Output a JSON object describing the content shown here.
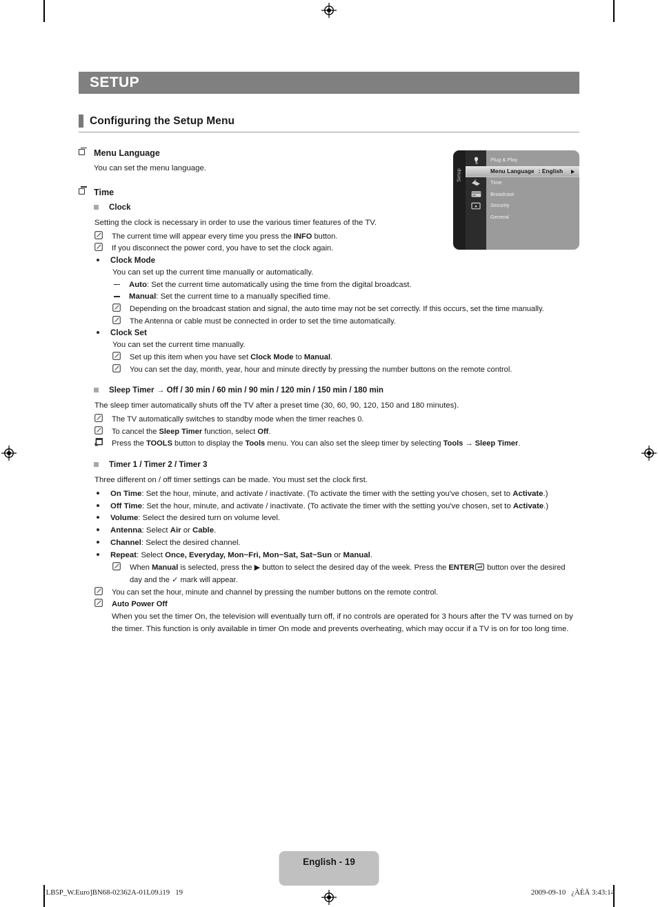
{
  "chapter": {
    "title": "SETUP"
  },
  "section": {
    "title": "Configuring the Setup Menu"
  },
  "menu_language": {
    "heading": "Menu Language",
    "body": "You can set the menu language."
  },
  "time": {
    "heading": "Time",
    "clock": {
      "heading": "Clock",
      "body": "Setting the clock is necessary in order to use the various timer features of the TV.",
      "note1_a": "The current time will appear every time you press the ",
      "note1_b": "INFO",
      "note1_c": " button.",
      "note2": "If you disconnect the power cord, you have to set the clock again.",
      "clock_mode": {
        "heading": "Clock Mode",
        "body": "You can set up the current time manually or automatically.",
        "auto_label": "Auto",
        "auto_text": ": Set the current time automatically using the time from the digital broadcast.",
        "manual_label": "Manual",
        "manual_text": ": Set the current time to a manually specified time.",
        "note1": "Depending on the broadcast station and signal, the auto time may not be set correctly. If this occurs, set the time manually.",
        "note2": "The Antenna or cable must be connected in order to set the time automatically."
      },
      "clock_set": {
        "heading": "Clock Set",
        "body": "You can set the current time manually.",
        "note1_a": "Set up this item when you have set ",
        "note1_b": "Clock Mode",
        "note1_c": " to ",
        "note1_d": "Manual",
        "note1_e": ".",
        "note2": "You can set the day, month, year, hour and minute directly by pressing the number buttons on the remote control."
      }
    },
    "sleep_timer": {
      "heading_label": "Sleep Timer",
      "heading_arrow": " → ",
      "heading_values": "Off / 30 min / 60 min / 90 min / 120 min / 150 min / 180 min",
      "body": "The sleep timer automatically shuts off the TV after a preset time (30, 60, 90, 120, 150 and 180 minutes).",
      "note1": "The TV automatically switches to standby mode when the timer reaches 0.",
      "note2_a": "To cancel the ",
      "note2_b": "Sleep Timer",
      "note2_c": " function, select ",
      "note2_d": "Off",
      "note2_e": ".",
      "tools_a": "Press the ",
      "tools_b": "TOOLS",
      "tools_c": " button to display the ",
      "tools_d": "Tools",
      "tools_e": " menu. You can also set the sleep timer by selecting ",
      "tools_f": "Tools → Sleep Timer",
      "tools_g": "."
    },
    "timers": {
      "heading": "Timer 1 / Timer 2 / Timer 3",
      "body": "Three different on / off timer settings can be made. You must set the clock first.",
      "items": [
        {
          "label": "On Time",
          "text_a": ": Set the hour, minute, and activate / inactivate. (To activate the timer with the setting you've chosen, set to ",
          "bold_b": "Activate",
          "text_c": ".)"
        },
        {
          "label": "Off Time",
          "text_a": ": Set the hour, minute, and activate / inactivate. (To activate the timer with the setting you've chosen, set to ",
          "bold_b": "Activate",
          "text_c": ".)"
        },
        {
          "label": "Volume",
          "text_a": ": Select the desired turn on volume level.",
          "bold_b": "",
          "text_c": ""
        },
        {
          "label": "Antenna",
          "text_a": ": Select ",
          "bold_b": "Air",
          "text_c": " or ",
          "bold_d": "Cable",
          "text_e": "."
        },
        {
          "label": "Channel",
          "text_a": ": Select the desired channel.",
          "bold_b": "",
          "text_c": ""
        },
        {
          "label": "Repeat",
          "text_a": ": Select ",
          "bold_b": "Once, Everyday, Mon~Fri, Mon~Sat, Sat~Sun",
          "text_c": " or ",
          "bold_d": "Manual",
          "text_e": "."
        }
      ],
      "note_manual_a": "When ",
      "note_manual_b": "Manual",
      "note_manual_c": " is selected, press the ",
      "note_manual_d": " button to select the desired day of the week. Press the ",
      "note_manual_e": "ENTER",
      "note_manual_f": " button over the desired day and the ",
      "note_manual_g": " mark will appear.",
      "note_numbers": "You can set the hour, minute and channel by pressing the number buttons on the remote control.",
      "auto_power_off": {
        "heading": "Auto Power Off",
        "body": "When you set the timer On, the television will eventually turn off, if no controls are operated for 3 hours after the TV was turned on by the timer. This function is only available in timer On mode and prevents overheating, which may occur if a TV is on for too long time."
      }
    }
  },
  "osd": {
    "rail_label": "Setup",
    "items": [
      {
        "label": "Plug & Play",
        "value": "",
        "selected": false
      },
      {
        "label": "Menu Language",
        "value": ": English",
        "selected": true
      },
      {
        "label": "Time",
        "value": "",
        "selected": false
      },
      {
        "label": "Broadcast",
        "value": "",
        "selected": false
      },
      {
        "label": "Security",
        "value": "",
        "selected": false
      },
      {
        "label": "General",
        "value": "",
        "selected": false
      }
    ]
  },
  "footer": {
    "page_label": "English - 19",
    "left": "[LB5P_W.Euro]BN68-02362A-01L09.i19   19",
    "right": "2009-09-10   ¿ÀÈÄ 3:43:14"
  },
  "colors": {
    "banner": "#808080",
    "section_bar": "#7a7a7a",
    "badge": "#c0c0c0",
    "osd_bg": "#9b9b9b"
  }
}
